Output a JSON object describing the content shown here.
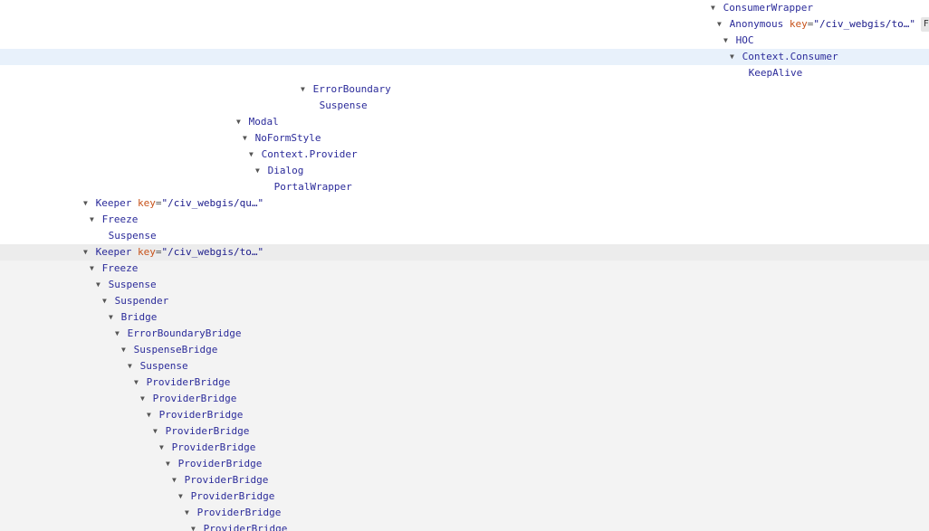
{
  "rows": [
    {
      "name": "ConsumerWrapper",
      "expanded": true,
      "state": ""
    },
    {
      "name": "Anonymous",
      "key": "\"/civ_webgis/to…\"",
      "badge": "F",
      "expanded": true,
      "state": ""
    },
    {
      "name": "HOC",
      "expanded": true,
      "state": ""
    },
    {
      "name": "Context.Consumer",
      "expanded": true,
      "state": "selected"
    },
    {
      "name": "KeepAlive",
      "expanded": false,
      "state": ""
    },
    {
      "name": "ErrorBoundary",
      "expanded": true,
      "state": ""
    },
    {
      "name": "Suspense",
      "expanded": false,
      "state": ""
    },
    {
      "name": "Modal",
      "expanded": true,
      "state": ""
    },
    {
      "name": "NoFormStyle",
      "expanded": true,
      "state": ""
    },
    {
      "name": "Context.Provider",
      "expanded": true,
      "state": ""
    },
    {
      "name": "Dialog",
      "expanded": true,
      "state": ""
    },
    {
      "name": "PortalWrapper",
      "expanded": false,
      "state": ""
    },
    {
      "name": "Keeper",
      "key": "\"/civ_webgis/qu…\"",
      "expanded": true,
      "state": ""
    },
    {
      "name": "Freeze",
      "expanded": true,
      "state": ""
    },
    {
      "name": "Suspense",
      "expanded": false,
      "state": ""
    },
    {
      "name": "Keeper",
      "key": "\"/civ_webgis/to…\"",
      "expanded": true,
      "state": "hovered"
    },
    {
      "name": "Freeze",
      "expanded": true,
      "state": "dim"
    },
    {
      "name": "Suspense",
      "expanded": true,
      "state": "dim"
    },
    {
      "name": "Suspender",
      "expanded": true,
      "state": "dim"
    },
    {
      "name": "Bridge",
      "expanded": true,
      "state": "dim"
    },
    {
      "name": "ErrorBoundaryBridge",
      "expanded": true,
      "state": "dim"
    },
    {
      "name": "SuspenseBridge",
      "expanded": true,
      "state": "dim"
    },
    {
      "name": "Suspense",
      "expanded": true,
      "state": "dim"
    },
    {
      "name": "ProviderBridge",
      "expanded": true,
      "state": "dim"
    },
    {
      "name": "ProviderBridge",
      "expanded": true,
      "state": "dim"
    },
    {
      "name": "ProviderBridge",
      "expanded": true,
      "state": "dim"
    },
    {
      "name": "ProviderBridge",
      "expanded": true,
      "state": "dim"
    },
    {
      "name": "ProviderBridge",
      "expanded": true,
      "state": "dim"
    },
    {
      "name": "ProviderBridge",
      "expanded": true,
      "state": "dim"
    },
    {
      "name": "ProviderBridge",
      "expanded": true,
      "state": "dim"
    },
    {
      "name": "ProviderBridge",
      "expanded": true,
      "state": "dim"
    },
    {
      "name": "ProviderBridge",
      "expanded": true,
      "state": "dim"
    },
    {
      "name": "ProviderBridge",
      "expanded": true,
      "state": "dim"
    }
  ],
  "key_attr_label": "key",
  "arrow_glyph": "▼"
}
